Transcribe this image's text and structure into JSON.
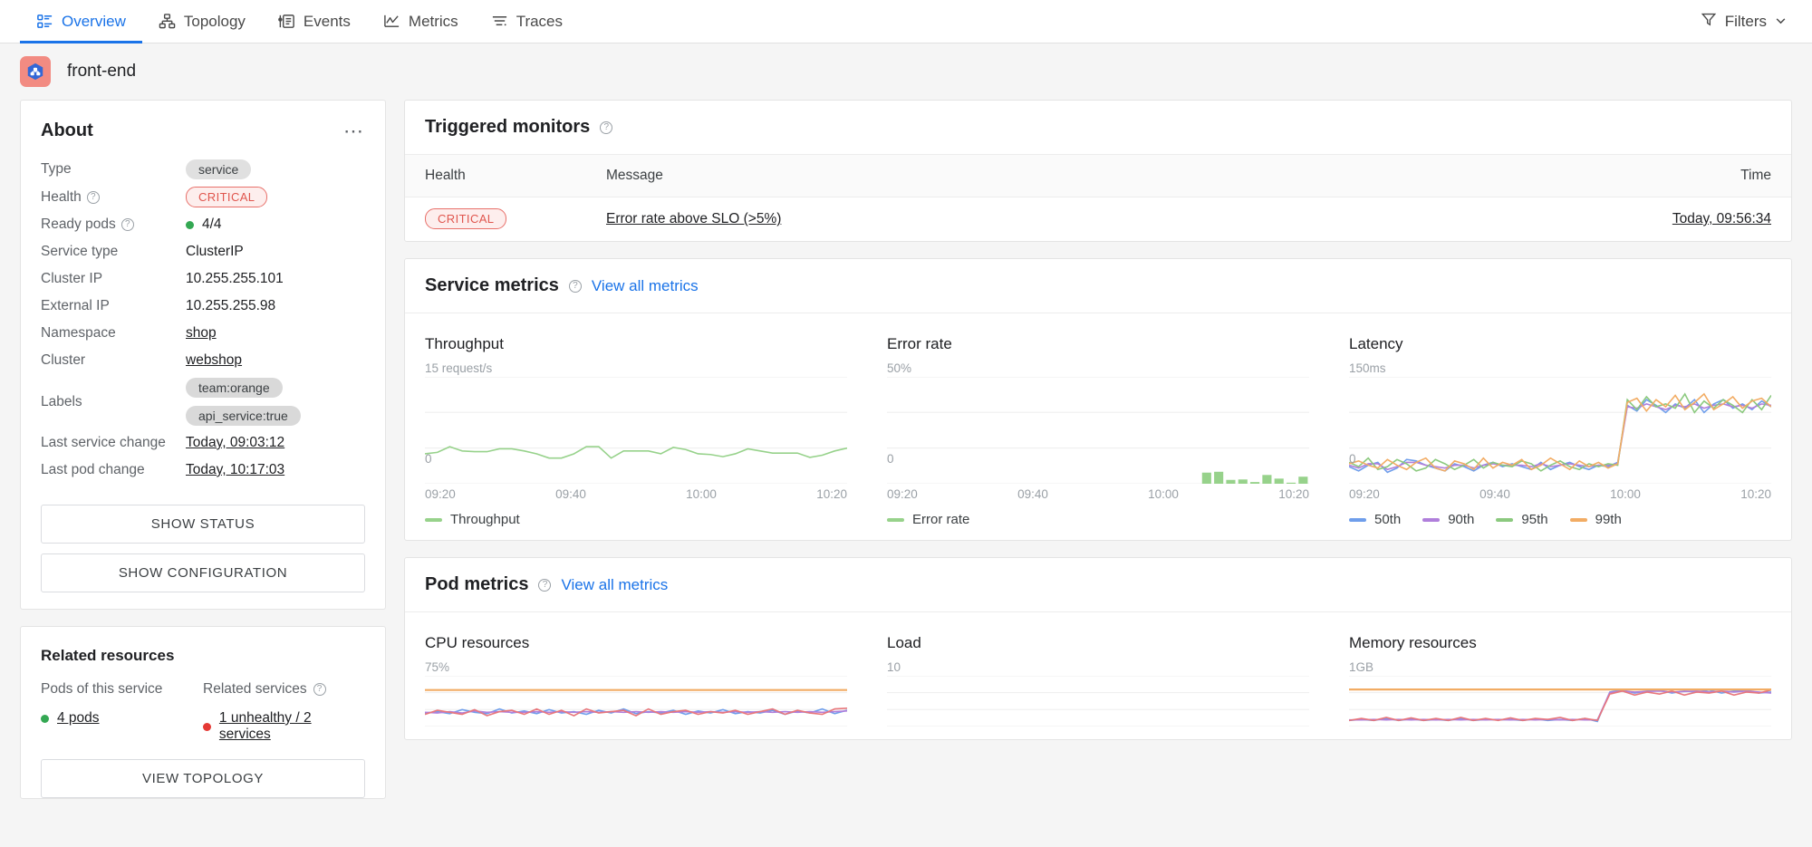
{
  "nav": {
    "tabs": [
      {
        "label": "Overview",
        "icon": "overview-icon",
        "active": true
      },
      {
        "label": "Topology",
        "icon": "topology-icon",
        "active": false
      },
      {
        "label": "Events",
        "icon": "events-icon",
        "active": false
      },
      {
        "label": "Metrics",
        "icon": "metrics-icon",
        "active": false
      },
      {
        "label": "Traces",
        "icon": "traces-icon",
        "active": false
      }
    ],
    "filters_label": "Filters",
    "filters_icon": "filter-icon",
    "chevron_icon": "chevron-down-icon",
    "accent": "#1a73e8"
  },
  "page": {
    "service_name": "front-end",
    "service_icon": "kubernetes-service-icon",
    "service_icon_bg": "#f28b82"
  },
  "about": {
    "title": "About",
    "menu_icon": "more-options-icon",
    "rows": [
      {
        "label": "Type",
        "help": false,
        "kind": "chip",
        "value": "service"
      },
      {
        "label": "Health",
        "help": true,
        "kind": "critical",
        "value": "CRITICAL"
      },
      {
        "label": "Ready pods",
        "help": true,
        "kind": "dot-green",
        "value": "4/4"
      },
      {
        "label": "Service type",
        "help": false,
        "kind": "text",
        "value": "ClusterIP"
      },
      {
        "label": "Cluster IP",
        "help": false,
        "kind": "text",
        "value": "10.255.255.101"
      },
      {
        "label": "External IP",
        "help": false,
        "kind": "text",
        "value": "10.255.255.98"
      },
      {
        "label": "Namespace",
        "help": false,
        "kind": "link",
        "value": "shop"
      },
      {
        "label": "Cluster",
        "help": false,
        "kind": "link",
        "value": "webshop"
      },
      {
        "label": "Labels",
        "help": false,
        "kind": "chips",
        "value": "team:orange",
        "value2": "api_service:true"
      },
      {
        "label": "Last service change",
        "help": false,
        "kind": "link",
        "value": "Today, 09:03:12"
      },
      {
        "label": "Last pod change",
        "help": false,
        "kind": "link",
        "value": "Today, 10:17:03"
      }
    ],
    "show_status_label": "SHOW STATUS",
    "show_configuration_label": "SHOW CONFIGURATION"
  },
  "related": {
    "title": "Related resources",
    "pods_label": "Pods of this service",
    "pods_value": "4 pods",
    "services_label": "Related services",
    "services_value": "1 unhealthy  /  2 services",
    "view_topology_label": "VIEW TOPOLOGY"
  },
  "triggered_monitors": {
    "title": "Triggered monitors",
    "help_icon": "help-icon",
    "columns": {
      "health": "Health",
      "message": "Message",
      "time": "Time"
    },
    "rows": [
      {
        "health": "CRITICAL",
        "message": "Error rate above SLO (>5%)",
        "time": "Today, 09:56:34"
      }
    ]
  },
  "service_metrics": {
    "title": "Service metrics",
    "help_icon": "help-icon",
    "view_all_label": "View all metrics"
  },
  "pod_metrics": {
    "title": "Pod metrics",
    "help_icon": "help-icon",
    "view_all_label": "View all metrics"
  },
  "chart_data": [
    {
      "id": "throughput",
      "type": "line",
      "title": "Throughput",
      "ymax_label": "15 request/s",
      "ymin_label": "0",
      "ylim": [
        0,
        15
      ],
      "grid": true,
      "xticks": [
        "09:20",
        "09:40",
        "10:00",
        "10:20"
      ],
      "legend": [
        {
          "name": "Throughput",
          "color": "#97d28b"
        }
      ],
      "legend_position": "bottom-left",
      "series": [
        {
          "name": "Throughput",
          "color": "#97d28b",
          "values": [
            4.2,
            4.4,
            5.2,
            4.6,
            4.5,
            4.5,
            4.9,
            4.9,
            4.6,
            4.2,
            3.6,
            3.6,
            4.2,
            5.2,
            5.2,
            3.6,
            4.6,
            4.6,
            4.6,
            4.2,
            5.1,
            4.8,
            4.2,
            4.1,
            3.8,
            4.2,
            4.9,
            4.6,
            4.3,
            4.3,
            4.3,
            3.7,
            4.0,
            4.6,
            5.0
          ]
        }
      ]
    },
    {
      "id": "error-rate",
      "type": "bar",
      "title": "Error rate",
      "ymax_label": "50%",
      "ymin_label": "0",
      "ylim": [
        0,
        50
      ],
      "grid": true,
      "xticks": [
        "09:20",
        "09:40",
        "10:00",
        "10:20"
      ],
      "legend": [
        {
          "name": "Error rate",
          "color": "#97d28b"
        }
      ],
      "legend_position": "bottom-left",
      "series": [
        {
          "name": "Error rate",
          "color": "#97d28b",
          "values": [
            0,
            0,
            0,
            0,
            0,
            0,
            0,
            0,
            0,
            0,
            0,
            0,
            0,
            0,
            0,
            0,
            0,
            0,
            0,
            0,
            0,
            0,
            0,
            0,
            0,
            0,
            5.2,
            5.6,
            1.8,
            2.0,
            0.8,
            4.1,
            2.4,
            0.5,
            3.3
          ]
        }
      ]
    },
    {
      "id": "latency",
      "type": "line",
      "title": "Latency",
      "ymax_label": "150ms",
      "ymin_label": "0",
      "ylim": [
        0,
        150
      ],
      "grid": true,
      "xticks": [
        "09:20",
        "09:40",
        "10:00",
        "10:20"
      ],
      "legend": [
        {
          "name": "50th",
          "color": "#6f9eeb"
        },
        {
          "name": "90th",
          "color": "#b07fdb"
        },
        {
          "name": "95th",
          "color": "#8bc97e"
        },
        {
          "name": "99th",
          "color": "#f2ac64"
        }
      ],
      "legend_position": "bottom-left",
      "series": [
        {
          "name": "50th",
          "color": "#6f9eeb",
          "values": [
            24,
            18,
            26,
            30,
            16,
            22,
            34,
            32,
            26,
            22,
            18,
            28,
            24,
            18,
            26,
            30,
            24,
            28,
            24,
            20,
            30,
            20,
            26,
            30,
            24,
            20,
            26,
            24,
            30,
            110,
            102,
            118,
            110,
            100,
            112,
            106,
            118,
            100,
            112,
            118,
            106,
            112,
            104,
            116,
            108
          ]
        },
        {
          "name": "90th",
          "color": "#b07fdb",
          "values": [
            26,
            22,
            28,
            28,
            20,
            24,
            30,
            30,
            26,
            24,
            22,
            26,
            26,
            22,
            26,
            28,
            26,
            26,
            26,
            24,
            28,
            24,
            26,
            28,
            26,
            24,
            26,
            26,
            28,
            108,
            106,
            112,
            108,
            104,
            110,
            108,
            112,
            106,
            110,
            112,
            108,
            110,
            106,
            112,
            110
          ]
        },
        {
          "name": "95th",
          "color": "#8bc97e",
          "values": [
            30,
            24,
            36,
            20,
            24,
            34,
            28,
            18,
            22,
            34,
            28,
            20,
            26,
            34,
            22,
            30,
            26,
            24,
            32,
            28,
            18,
            26,
            32,
            24,
            20,
            28,
            24,
            28,
            26,
            118,
            104,
            122,
            108,
            112,
            106,
            126,
            100,
            116,
            106,
            118,
            110,
            100,
            118,
            104,
            124
          ]
        },
        {
          "name": "99th",
          "color": "#f2ac64",
          "values": [
            28,
            32,
            26,
            22,
            34,
            26,
            20,
            30,
            36,
            22,
            18,
            32,
            28,
            20,
            36,
            22,
            30,
            26,
            34,
            20,
            26,
            36,
            28,
            20,
            32,
            24,
            30,
            22,
            28,
            114,
            120,
            102,
            118,
            108,
            124,
            104,
            114,
            126,
            104,
            112,
            122,
            106,
            116,
            120,
            108
          ]
        }
      ]
    },
    {
      "id": "cpu-resources",
      "type": "line",
      "title": "CPU resources",
      "ymax_label": "75%",
      "ylim": [
        0,
        75
      ],
      "grid": true,
      "limit_line": {
        "color": "#f2ac64",
        "value": 54
      },
      "series": [
        {
          "name": "pod-1",
          "color": "#6f9eeb",
          "values": [
            20,
            22,
            19,
            25,
            21,
            19,
            26,
            20,
            23,
            19,
            25,
            20,
            22,
            18,
            24,
            20,
            26,
            19,
            22,
            20,
            24,
            18,
            23,
            20,
            25,
            19,
            22,
            20,
            24,
            18,
            23,
            20,
            26,
            19,
            24
          ]
        },
        {
          "name": "pod-2",
          "color": "#b07fdb",
          "values": [
            21,
            20,
            22,
            20,
            23,
            21,
            22,
            21,
            21,
            22,
            21,
            22,
            21,
            22,
            21,
            22,
            21,
            22,
            21,
            22,
            21,
            22,
            21,
            22,
            21,
            22,
            21,
            22,
            21,
            22,
            21,
            22,
            21,
            22,
            23
          ]
        },
        {
          "name": "pod-3",
          "color": "#e8767b",
          "values": [
            18,
            24,
            21,
            18,
            25,
            16,
            22,
            24,
            18,
            26,
            18,
            24,
            16,
            26,
            20,
            22,
            24,
            16,
            26,
            18,
            22,
            24,
            18,
            22,
            20,
            24,
            18,
            22,
            26,
            18,
            24,
            20,
            18,
            26,
            27
          ]
        }
      ]
    },
    {
      "id": "load",
      "type": "line",
      "title": "Load",
      "ymax_label": "10",
      "ylim": [
        0,
        10
      ],
      "grid": true,
      "series": []
    },
    {
      "id": "memory-resources",
      "type": "line",
      "title": "Memory resources",
      "ymax_label": "1GB",
      "ylim": [
        0,
        1
      ],
      "grid": true,
      "limit_line": {
        "color": "#f2ac64",
        "value": 0.73
      },
      "series": [
        {
          "name": "pod-1",
          "color": "#6f9eeb",
          "values": [
            0.12,
            0.14,
            0.12,
            0.16,
            0.12,
            0.15,
            0.12,
            0.14,
            0.12,
            0.16,
            0.12,
            0.14,
            0.13,
            0.14,
            0.12,
            0.15,
            0.12,
            0.14,
            0.12,
            0.16,
            0.1,
            0.68,
            0.72,
            0.66,
            0.7,
            0.72,
            0.66,
            0.7,
            0.68,
            0.72,
            0.66,
            0.7,
            0.72,
            0.66,
            0.68
          ]
        },
        {
          "name": "pod-2",
          "color": "#b07fdb",
          "values": [
            0.13,
            0.13,
            0.14,
            0.13,
            0.14,
            0.13,
            0.14,
            0.13,
            0.14,
            0.13,
            0.14,
            0.13,
            0.14,
            0.13,
            0.14,
            0.13,
            0.14,
            0.13,
            0.14,
            0.13,
            0.13,
            0.67,
            0.7,
            0.68,
            0.69,
            0.7,
            0.68,
            0.69,
            0.7,
            0.68,
            0.7,
            0.68,
            0.7,
            0.68,
            0.66
          ]
        },
        {
          "name": "pod-3",
          "color": "#e8767b",
          "values": [
            0.12,
            0.16,
            0.12,
            0.18,
            0.12,
            0.17,
            0.12,
            0.16,
            0.12,
            0.18,
            0.12,
            0.16,
            0.12,
            0.17,
            0.12,
            0.16,
            0.14,
            0.18,
            0.12,
            0.16,
            0.12,
            0.64,
            0.7,
            0.62,
            0.68,
            0.64,
            0.7,
            0.62,
            0.68,
            0.66,
            0.7,
            0.62,
            0.68,
            0.66,
            0.72
          ]
        }
      ]
    }
  ]
}
